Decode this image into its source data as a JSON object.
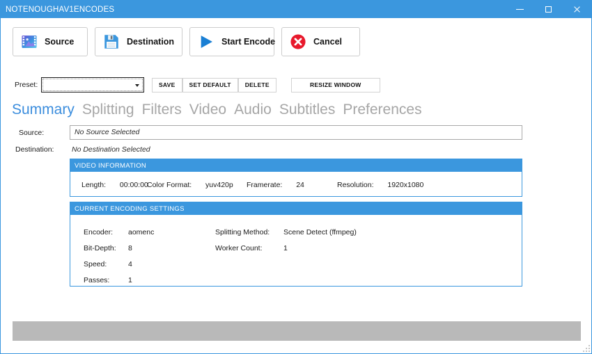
{
  "window": {
    "title": "NOTENOUGHAV1ENCODES",
    "accent_color": "#3b97de",
    "controls": {
      "minimize": "minimize-icon",
      "maximize": "maximize-icon",
      "close": "close-icon"
    }
  },
  "toolbar": {
    "buttons": [
      {
        "label": "Source",
        "icon": "media-file-icon"
      },
      {
        "label": "Destination",
        "icon": "floppy-save-icon"
      },
      {
        "label": "Start Encode",
        "icon": "play-triangle-icon"
      },
      {
        "label": "Cancel",
        "icon": "red-circle-x-icon"
      }
    ]
  },
  "preset": {
    "label": "Preset:",
    "value": "",
    "placeholder": "",
    "dropdown_icon": "chevron-down-icon",
    "save_label": "SAVE",
    "set_default_label": "SET DEFAULT",
    "delete_label": "DELETE",
    "resize_window_label": "RESIZE WINDOW"
  },
  "tabs": [
    {
      "label": "Summary",
      "active": true
    },
    {
      "label": "Splitting",
      "active": false
    },
    {
      "label": "Filters",
      "active": false
    },
    {
      "label": "Video",
      "active": false
    },
    {
      "label": "Audio",
      "active": false
    },
    {
      "label": "Subtitles",
      "active": false
    },
    {
      "label": "Preferences",
      "active": false
    }
  ],
  "summary": {
    "source_label": "Source:",
    "source_value": "No Source Selected",
    "destination_label": "Destination:",
    "destination_value": "No Destination Selected"
  },
  "video_information": {
    "title": "VIDEO INFORMATION",
    "fields": [
      {
        "key": "Length:",
        "value": "00:00:00"
      },
      {
        "key": "Color Format:",
        "value": "yuv420p"
      },
      {
        "key": "Framerate:",
        "value": "24"
      },
      {
        "key": "Resolution:",
        "value": "1920x1080"
      }
    ]
  },
  "current_encoding_settings": {
    "title": "CURRENT ENCODING SETTINGS",
    "left_column": [
      {
        "key": "Encoder:",
        "value": "aomenc"
      },
      {
        "key": "Bit-Depth:",
        "value": "8"
      },
      {
        "key": "Speed:",
        "value": "4"
      },
      {
        "key": "Passes:",
        "value": "1"
      }
    ],
    "right_column": [
      {
        "key": "Splitting Method:",
        "value": "Scene Detect (ffmpeg)"
      },
      {
        "key": "Worker Count:",
        "value": "1"
      }
    ]
  },
  "progress": {
    "percent": 0,
    "track_color": "#b9b9b9",
    "fill_color": "#3b97de"
  }
}
